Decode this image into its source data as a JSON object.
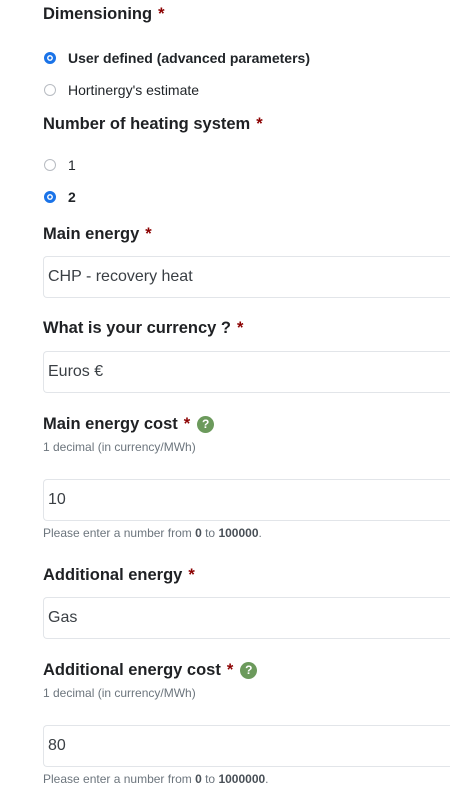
{
  "dimensioning": {
    "label": "Dimensioning",
    "required_mark": "*",
    "options": [
      {
        "label": "User defined (advanced parameters)",
        "checked": true
      },
      {
        "label": "Hortinergy's estimate",
        "checked": false
      }
    ]
  },
  "heating_systems": {
    "label": "Number of heating system",
    "required_mark": "*",
    "options": [
      {
        "label": "1",
        "checked": false
      },
      {
        "label": "2",
        "checked": true
      }
    ]
  },
  "main_energy": {
    "label": "Main energy",
    "required_mark": "*",
    "value": "CHP - recovery heat"
  },
  "currency": {
    "label": "What is your currency ?",
    "required_mark": "*",
    "value": "Euros €"
  },
  "main_energy_cost": {
    "label": "Main energy cost",
    "required_mark": "*",
    "help_icon": "?",
    "hint": "1 decimal (in currency/MWh)",
    "value": "10",
    "validation_prefix": "Please enter a number from ",
    "min": "0",
    "validation_mid": " to ",
    "max": "100000",
    "validation_suffix": "."
  },
  "additional_energy": {
    "label": "Additional energy",
    "required_mark": "*",
    "value": "Gas"
  },
  "additional_energy_cost": {
    "label": "Additional energy cost",
    "required_mark": "*",
    "help_icon": "?",
    "hint": "1 decimal (in currency/MWh)",
    "value": "80",
    "validation_prefix": "Please enter a number from ",
    "min": "0",
    "validation_mid": " to ",
    "max": "1000000",
    "validation_suffix": "."
  },
  "colors": {
    "required": "#8b0000",
    "radio_checked": "#1a73e8",
    "help_icon": "#6c9a5c",
    "field_border": "#e2e5e9"
  }
}
